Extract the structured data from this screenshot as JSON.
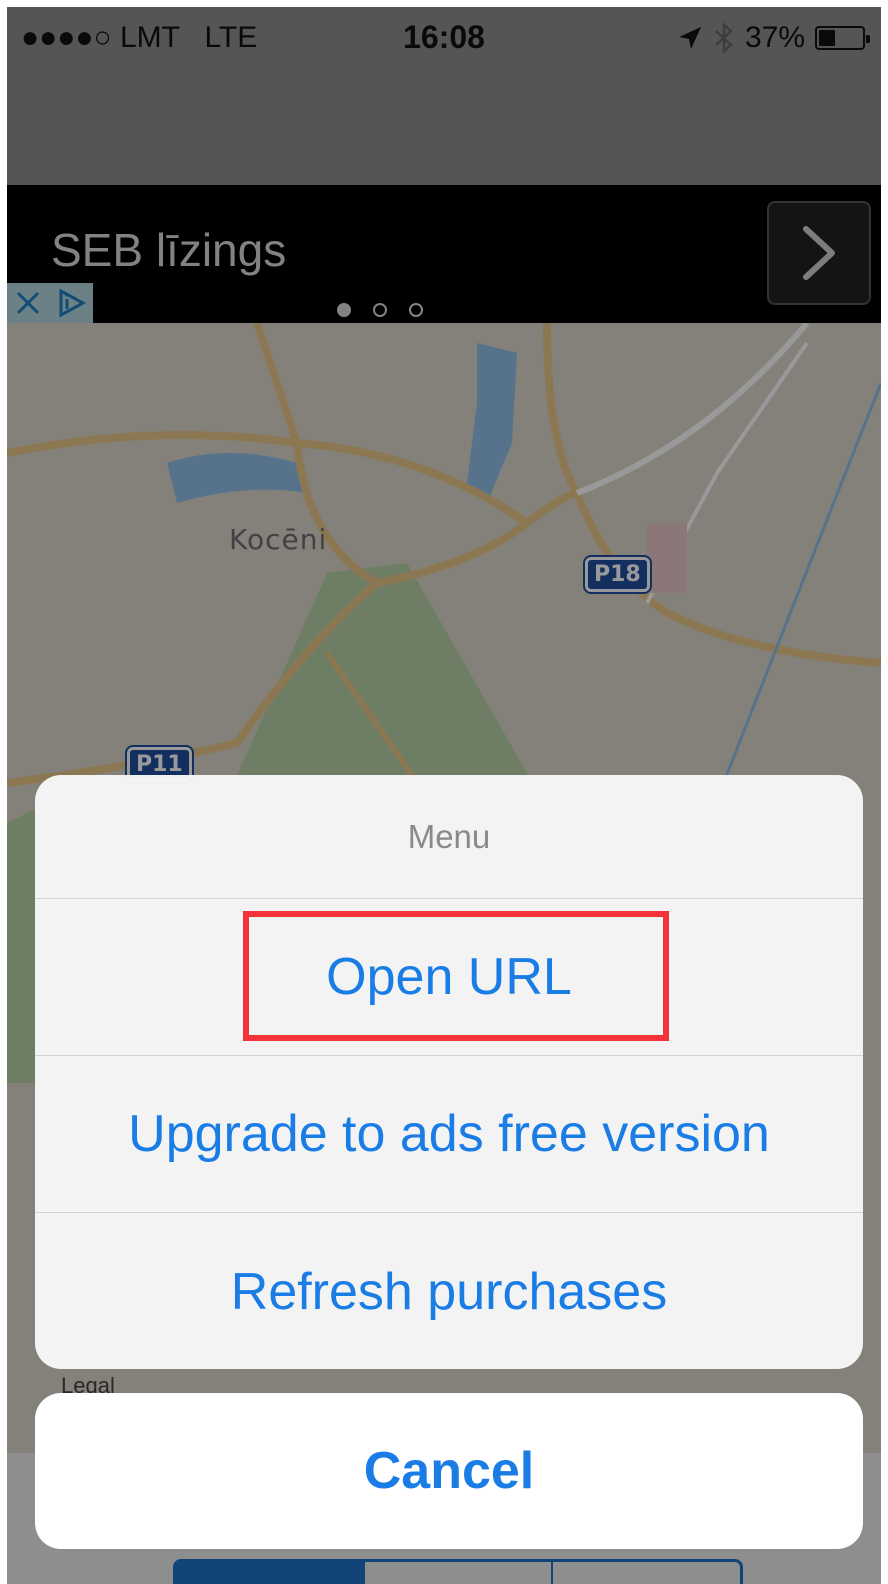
{
  "status_bar": {
    "signal": "●●●●○",
    "carrier": "LMT",
    "network": "LTE",
    "time": "16:08",
    "battery_percent": "37%",
    "battery_level": 0.37
  },
  "ad": {
    "title": "SEB līzings",
    "page_count": 3,
    "active_page": 1
  },
  "map": {
    "place_label": "Kocēni",
    "road_shields": [
      "P18",
      "P11"
    ],
    "legal_label": "Legal"
  },
  "action_sheet": {
    "title": "Menu",
    "items": [
      {
        "label": "Open URL",
        "highlighted": true
      },
      {
        "label": "Upgrade to ads free version",
        "highlighted": false
      },
      {
        "label": "Refresh purchases",
        "highlighted": false
      }
    ],
    "cancel_label": "Cancel"
  },
  "colors": {
    "accent": "#1a7de6",
    "highlight_border": "#f2333a",
    "shield_blue": "#1e4fa0",
    "ad_background": "#000000"
  },
  "icons": [
    "location-arrow-icon",
    "bluetooth-icon",
    "battery-icon",
    "chevron-right-icon",
    "close-icon",
    "adchoices-icon"
  ]
}
